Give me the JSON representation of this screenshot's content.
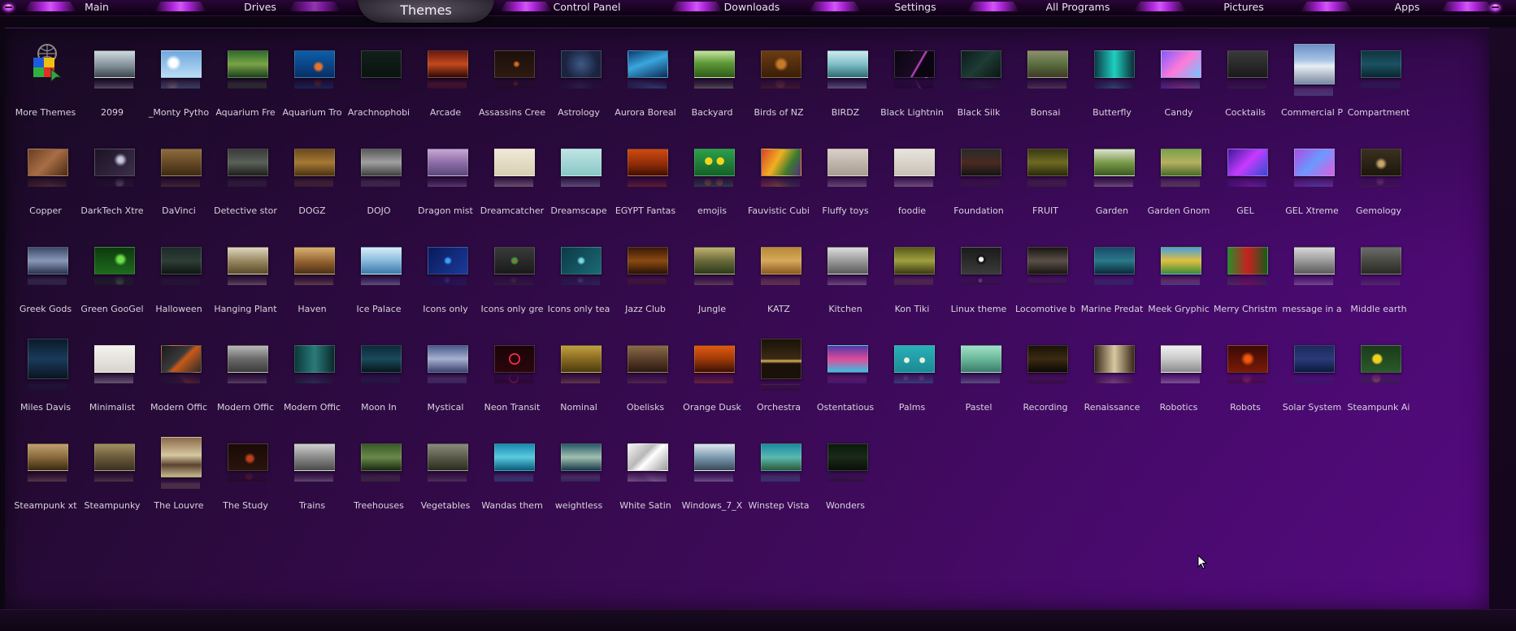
{
  "colors": {
    "accent": "#c22ee6",
    "panel": "#3c0b58",
    "text": "#d8d3dc"
  },
  "tabs": [
    {
      "label": "Main"
    },
    {
      "label": "Drives"
    },
    {
      "label": "Themes",
      "active": true
    },
    {
      "label": "Control Panel"
    },
    {
      "label": "Downloads"
    },
    {
      "label": "Settings"
    },
    {
      "label": "All Programs"
    },
    {
      "label": "Pictures"
    },
    {
      "label": "Apps"
    }
  ],
  "themes": [
    {
      "label": "More Themes",
      "icon": "more-themes-icon"
    },
    {
      "label": "2099",
      "bg": "linear-gradient(#cfd8df,#7b8a93 60%,#3b444a)"
    },
    {
      "label": "_Monty Pytho",
      "bg": "radial-gradient(circle at 30% 45%,#fff 0 12%,transparent 25%),linear-gradient(#6fa8de,#bcdcf4)"
    },
    {
      "label": "Aquarium Fre",
      "bg": "linear-gradient(#2f6b2a,#79a446 50%,#1e3e1e)"
    },
    {
      "label": "Aquarium Tro",
      "bg": "radial-gradient(circle at 60% 60%,#e8742a 0 10%,transparent 20%),linear-gradient(#0d5ea8,#0a2f66)"
    },
    {
      "label": "Arachnophobi",
      "bg": "linear-gradient(#10201a,#0a130f)"
    },
    {
      "label": "Arcade",
      "bg": "linear-gradient(#6a1a0e,#c2491d 50%,#2e0906)"
    },
    {
      "label": "Assassins Cree",
      "bg": "radial-gradient(circle at 55% 50%,#d9691c 0 6%,transparent 14%),linear-gradient(#1b0f0b,#2e1a10)"
    },
    {
      "label": "Astrology",
      "bg": "radial-gradient(circle at 50% 50%,#3f5a86,#1a2340 70%)"
    },
    {
      "label": "Aurora Boreal",
      "bg": "linear-gradient(160deg,#0c3a6e,#3aa6de 45%,#0d2a55)"
    },
    {
      "label": "Backyard",
      "bg": "linear-gradient(#c6e4a2,#5f9a37 45%,#2f5a1a)"
    },
    {
      "label": "Birds of NZ",
      "bg": "radial-gradient(circle at 50% 50%,#c77a2a 0 15%,transparent 30%),linear-gradient(#6b3c12,#3a1e08)"
    },
    {
      "label": "BIRDZ",
      "bg": "linear-gradient(#cfe9ef,#7fbfc8 50%,#2e6a70)"
    },
    {
      "label": "Black Lightnin",
      "bg": "linear-gradient(120deg,#0a0510,#1a0b24 55%,#d84be0 58%,#0a0510 62%)"
    },
    {
      "label": "Black Silk",
      "bg": "linear-gradient(135deg,#0b1b18,#1e3b35 50%,#0b1612)"
    },
    {
      "label": "Bonsai",
      "bg": "linear-gradient(#8b8f6e,#5a6e3e 50%,#3d3a26)"
    },
    {
      "label": "Butterfly",
      "bg": "linear-gradient(90deg,#0d3c4a,#1fd0c0 50%,#0a2e36)"
    },
    {
      "label": "Candy",
      "bg": "linear-gradient(135deg,#7b5cff,#ff7ad9 50%,#6cc7ff)"
    },
    {
      "label": "Cocktails",
      "bg": "linear-gradient(#3a3a3a,#1a1a1a)"
    },
    {
      "label": "Commercial P",
      "tall": true,
      "bg": "linear-gradient(#6a90c8,#aac4e6 40%,#e9eef4 55%,#7a8aa0)"
    },
    {
      "label": "Compartment",
      "bg": "linear-gradient(#0f3340,#1a5262 50%,#0b2630)"
    },
    {
      "label": "Copper",
      "bg": "linear-gradient(135deg,#6b3e22,#a86e45 50%,#4a2a16)"
    },
    {
      "label": "DarkTech Xtre",
      "bg": "radial-gradient(circle at 65% 40%,#c9c9e0 0 8%,transparent 22%),linear-gradient(135deg,#1b1424,#3c2e4a)"
    },
    {
      "label": "DaVinci",
      "bg": "linear-gradient(#8e6b3c,#5e4322 60%,#3b2a15)"
    },
    {
      "label": "Detective stor",
      "bg": "linear-gradient(#3a3a3a,#5a6058 50%,#1e1f1c)"
    },
    {
      "label": "DOGZ",
      "bg": "linear-gradient(#6b4a1c,#a67a35 50%,#4b3312)"
    },
    {
      "label": "DOJO",
      "bg": "linear-gradient(#5a5a5a,#a0a0a0 50%,#404040)"
    },
    {
      "label": "Dragon mist",
      "bg": "linear-gradient(#c9a6d6,#8d6ea8 50%,#5a4878)"
    },
    {
      "label": "Dreamcatcher",
      "bg": "linear-gradient(#efe9d8,#d8ceb2)"
    },
    {
      "label": "Dreamscape",
      "bg": "linear-gradient(#bfe4e2,#88c8c6)"
    },
    {
      "label": "EGYPT Fantas",
      "bg": "linear-gradient(#ce4a10,#8a2a08 60%,#3b1004)"
    },
    {
      "label": "emojis",
      "bg": "radial-gradient(circle at 35% 45%,#f5d61a 0 12%,transparent 14%),radial-gradient(circle at 65% 45%,#f5d61a 0 12%,transparent 14%),linear-gradient(#2aa04a,#15602a)"
    },
    {
      "label": "Fauvistic Cubi",
      "bg": "linear-gradient(120deg,#d8402a,#f0b020 40%,#3a7a30 70%,#5a2a80)"
    },
    {
      "label": "Fluffy toys",
      "bg": "linear-gradient(#d8d0c8,#a89c90)"
    },
    {
      "label": "foodie",
      "bg": "linear-gradient(#e8e4dc,#c9c2b6)"
    },
    {
      "label": "Foundation",
      "bg": "linear-gradient(#2a2a28,#4a2a22 50%,#141414)"
    },
    {
      "label": "FRUIT",
      "bg": "linear-gradient(#3a3a12,#6e6a22 50%,#2a2a0c)"
    },
    {
      "label": "Garden",
      "bg": "linear-gradient(#dce3d0,#7c9a4a 50%,#3a5a20)"
    },
    {
      "label": "Garden Gnom",
      "bg": "linear-gradient(#7aa04a,#b6b060 50%,#4a6a2a)"
    },
    {
      "label": "GEL",
      "bg": "linear-gradient(135deg,#3a1a9a,#c83aff 50%,#2a50d0)"
    },
    {
      "label": "GEL Xtreme",
      "bg": "linear-gradient(135deg,#b04adf,#6a9aff 50%,#e45adc)"
    },
    {
      "label": "Gemology",
      "bg": "radial-gradient(circle at 50% 55%,#c8a86a 0 10%,transparent 25%),linear-gradient(#3a3020,#1c160c)"
    },
    {
      "label": "Greek Gods",
      "bg": "linear-gradient(#3a4a6a,#8a98b8 50%,#2a3450)"
    },
    {
      "label": "Green GooGel",
      "bg": "radial-gradient(circle at 65% 45%,#6ee04a 0 10%,transparent 22%),linear-gradient(#0c3a0c,#1e6a1e)"
    },
    {
      "label": "Halloween",
      "bg": "linear-gradient(#1c2a2a,#2e3e36 50%,#0e1612)"
    },
    {
      "label": "Hanging Plant",
      "bg": "linear-gradient(#ded6c0,#9a8a62 50%,#5a4a2a)"
    },
    {
      "label": "Haven",
      "bg": "linear-gradient(#d8b070,#8a5a2a 60%,#4a3018)"
    },
    {
      "label": "Ice Palace",
      "bg": "linear-gradient(#d8ecf8,#8abadc 50%,#3a78a8)"
    },
    {
      "label": "Icons only",
      "bg": "radial-gradient(circle at 50% 50%,#3aa0ff 0 8%,transparent 18%),linear-gradient(135deg,#0a1a5a,#1a3a9a)"
    },
    {
      "label": "Icons only gre",
      "bg": "radial-gradient(circle at 50% 50%,#e04a2a 0 6%,#3aa040 6% 10%,transparent 18%),linear-gradient(#3a3a3a,#1a1a1a)"
    },
    {
      "label": "Icons only tea",
      "bg": "radial-gradient(circle at 50% 50%,#7ad8e0 0 8%,transparent 18%),linear-gradient(135deg,#0a3a44,#1a6a76)"
    },
    {
      "label": "Jazz Club",
      "bg": "linear-gradient(#3a1a08,#8a4a12 50%,#2a1206)"
    },
    {
      "label": "Jungle",
      "bg": "linear-gradient(#c0b070,#6a6a3a 50%,#2a3a1a)"
    },
    {
      "label": "KATZ",
      "bg": "linear-gradient(#b88a3a,#d6aa5a 50%,#8a5a22)"
    },
    {
      "label": "Kitchen",
      "bg": "linear-gradient(#dcdcdc,#9a9a9a 50%,#5a5a5a)"
    },
    {
      "label": "Kon Tiki",
      "bg": "linear-gradient(#5a5a1a,#a0a040 50%,#3a3a12)"
    },
    {
      "label": "Linux theme",
      "bg": "radial-gradient(circle at 50% 45%,#f0f0f0 0 10%,#1a1a1a 11% 20%,transparent 22%),linear-gradient(#1a1a1a,#3a3a3a)"
    },
    {
      "label": "Locomotive b",
      "bg": "linear-gradient(#1a1612,#5a5048 50%,#1a1612)"
    },
    {
      "label": "Marine Predat",
      "bg": "linear-gradient(#1a4a6a,#2a7a8a 50%,#0a2a3a)"
    },
    {
      "label": "Meek Gryphic",
      "bg": "linear-gradient(#4aa0d8,#e0c040 50%,#3a8a3a)"
    },
    {
      "label": "Merry Christm",
      "bg": "linear-gradient(90deg,#2a8a2a,#c82020 50%,#1a5a1a)"
    },
    {
      "label": "message in a",
      "bg": "linear-gradient(#d8d8d8,#9a9a9a 50%,#5a5a5a)"
    },
    {
      "label": "Middle earth",
      "bg": "linear-gradient(#6a6a6a,#4a4a44 50%,#2a2a26)"
    },
    {
      "label": "Miles Davis",
      "tall": true,
      "bg": "linear-gradient(#0a1a2a,#1a3a5a 50%,#0a1420)"
    },
    {
      "label": "Minimalist",
      "bg": "linear-gradient(#f4f2ee,#d8d4cc)"
    },
    {
      "label": "Modern Offic",
      "bg": "linear-gradient(135deg,#1a1a1a,#3a3a3a 45%,#c85a1a 55%,#2a2a2a)"
    },
    {
      "label": "Modern Offic",
      "bg": "linear-gradient(#b8b8b8,#6a6a6a 50%,#3a3a3a)"
    },
    {
      "label": "Modern Offic",
      "bg": "linear-gradient(90deg,#0a3a3a,#2a7a7a 50%,#0a2a2a)"
    },
    {
      "label": "Moon In",
      "bg": "linear-gradient(#0a2a3a,#1a4a5a 50%,#06161e)"
    },
    {
      "label": "Mystical",
      "bg": "linear-gradient(#4a5a8a,#a8b0d0 50%,#3a4270)"
    },
    {
      "label": "Neon Transit",
      "bg": "radial-gradient(circle at 50% 50%,transparent 0 18%,#ff2a4a 19% 24%,transparent 25%),linear-gradient(#1a0408,#2a060c)"
    },
    {
      "label": "Nominal",
      "bg": "linear-gradient(#c0a040,#8a6a20 50%,#4a3a10)"
    },
    {
      "label": "Obelisks",
      "bg": "linear-gradient(#8a6a4a,#5a3e2a 50%,#2a1a10)"
    },
    {
      "label": "Orange Dusk",
      "bg": "linear-gradient(#e05a10,#a03a08 50%,#3a1004)"
    },
    {
      "label": "Orchestra",
      "tall": true,
      "bg": "linear-gradient(#1a1208,#3a2a12 50%,#e0b060 55%,#1a1208 62%)"
    },
    {
      "label": "Ostentatious",
      "bg": "linear-gradient(#4a3aaa,#e04a9a 50%,#3ac0e0)"
    },
    {
      "label": "Palms",
      "bg": "radial-gradient(circle at 30% 55%,#e8f0e0 0 8%,transparent 10%),radial-gradient(circle at 70% 55%,#e8f0e0 0 8%,transparent 10%),linear-gradient(#2ab0b8,#1a8a94)"
    },
    {
      "label": "Pastel",
      "bg": "linear-gradient(#a0e0c8,#6ab89a 50%,#3a7a6a)"
    },
    {
      "label": "Recording",
      "bg": "linear-gradient(#1a1206,#3a2a12 50%,#0a0804)"
    },
    {
      "label": "Renaissance",
      "bg": "linear-gradient(90deg,#3a2a1a,#d8c8a0 50%,#3a2a1a)"
    },
    {
      "label": "Robotics",
      "bg": "linear-gradient(#f0f0f0,#c8c8c8 50%,#8a8a8a)"
    },
    {
      "label": "Robots",
      "bg": "radial-gradient(circle at 50% 50%,#f05a10 0 12%,transparent 30%),linear-gradient(#3a0a04,#7a1a08)"
    },
    {
      "label": "Solar System",
      "bg": "linear-gradient(#1a2a5a,#2a3a7a 50%,#0a1a3a)"
    },
    {
      "label": "Steampunk Ai",
      "bg": "radial-gradient(circle at 40% 50%,#f0d020 0 14%,transparent 22%),linear-gradient(#1a3a1a,#2a5a2a)"
    },
    {
      "label": "Steampunk xt",
      "bg": "linear-gradient(#c0a070,#8a6a3a 50%,#3a2a12)"
    },
    {
      "label": "Steampunky",
      "bg": "linear-gradient(#a09060,#6a5a3a 50%,#3a3020)"
    },
    {
      "label": "The Louvre",
      "tall": true,
      "bg": "linear-gradient(#8a6a4a,#d8c8a0 45%,#5a4230 70%,#c8b890)"
    },
    {
      "label": "The Study",
      "bg": "radial-gradient(circle at 55% 55%,#c0401a 0 10%,transparent 22%),linear-gradient(#1a0a06,#2a140c)"
    },
    {
      "label": "Trains",
      "bg": "linear-gradient(#d0d0d0,#8a8a8a 50%,#4a4a4a)"
    },
    {
      "label": "Treehouses",
      "bg": "linear-gradient(#3a5a2a,#6a8a4a 50%,#1a2a12)"
    },
    {
      "label": "Vegetables",
      "bg": "linear-gradient(#8a8a7a,#5a5a4a 50%,#2a2a20)"
    },
    {
      "label": "Wandas them",
      "bg": "linear-gradient(#1a8ab0,#5acae0 50%,#0a5a7a)"
    },
    {
      "label": "weightless",
      "bg": "linear-gradient(#2a5a6a,#a0c0b0 50%,#1a3a4a)"
    },
    {
      "label": "White Satin",
      "bg": "linear-gradient(135deg,#f4f4f4,#b8b8b8 40%,#ffffff 55%,#9a9a9a)"
    },
    {
      "label": "Windows_7_X",
      "bg": "linear-gradient(#e0e8f0,#7a9ab0 50%,#3a4a5a)"
    },
    {
      "label": "Winstep Vista",
      "bg": "linear-gradient(#1a8aa0,#5abab0 50%,#2a5a3a)"
    },
    {
      "label": "Wonders",
      "bg": "linear-gradient(#0a1a0a,#1a2a1a 50%,#0a0e0a)"
    }
  ]
}
